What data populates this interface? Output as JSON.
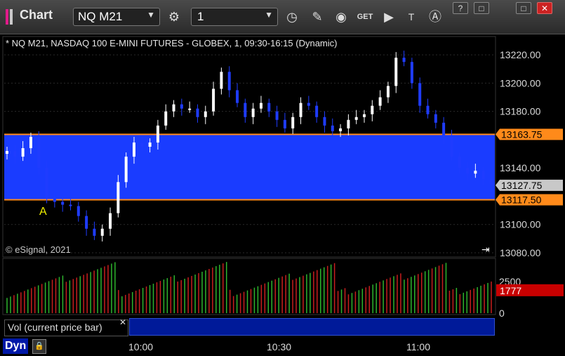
{
  "window": {
    "title": "Chart",
    "symbol": "NQ M21",
    "interval": "1",
    "buttons": {
      "minimize": "?",
      "restore": "□",
      "maximize": "□",
      "close": "✕"
    }
  },
  "toolbar_icons": [
    "gear-icon",
    "clock-icon",
    "pencil-icon",
    "study-icon",
    "get-icon",
    "play-icon",
    "text-icon",
    "alert-icon"
  ],
  "chart_header": "* NQ M21, NASDAQ 100 E-MINI FUTURES - GLOBEX, 1, 09:30-16:15 (Dynamic)",
  "copyright": "© eSignal, 2021",
  "volume_study_label": "Vol (current price bar)",
  "dyn_label": "Dyn",
  "colors": {
    "band": "#1a3cff",
    "band_edge": "#ff8a1a",
    "up": "#ffffff",
    "down": "#1f3cff",
    "vol_up": "#2db52d",
    "vol_down": "#c81e1e"
  },
  "chart_data": {
    "type": "candlestick",
    "price_axis": {
      "ticks": [
        "13220.00",
        "13200.00",
        "13180.00",
        "13140.00",
        "13100.00",
        "13080.00"
      ],
      "range": [
        13077,
        13233
      ]
    },
    "price_labels": [
      {
        "text": "13163.75",
        "value": 13163.75,
        "color": "#ff8a1a"
      },
      {
        "text": "13127.75",
        "value": 13127.75,
        "color": "#c8c8c8"
      },
      {
        "text": "13117.50",
        "value": 13117.5,
        "color": "#ff8a1a"
      }
    ],
    "band": {
      "high": 13163.75,
      "low": 13117.5
    },
    "marker": {
      "text": "A"
    },
    "time_ticks": [
      "10:00",
      "10:30",
      "11:00"
    ],
    "volume_axis": {
      "ticks": [
        "2500",
        "0"
      ],
      "current_label": "1777",
      "max": 4200
    },
    "closes": [
      13152,
      13148,
      13154,
      13162,
      13140,
      13118,
      13116,
      13114,
      13113,
      13106,
      13097,
      13092,
      13097,
      13108,
      13130,
      13148,
      13158,
      13155,
      13158,
      13170,
      13180,
      13185,
      13182,
      13182,
      13176,
      13180,
      13196,
      13208,
      13195,
      13186,
      13176,
      13182,
      13186,
      13180,
      13174,
      13168,
      13176,
      13186,
      13184,
      13176,
      13170,
      13166,
      13168,
      13174,
      13176,
      13178,
      13184,
      13190,
      13198,
      13218,
      13215,
      13200,
      13184,
      13178,
      13172,
      13162,
      13148,
      13140,
      13136,
      13138,
      13132,
      13128
    ]
  }
}
